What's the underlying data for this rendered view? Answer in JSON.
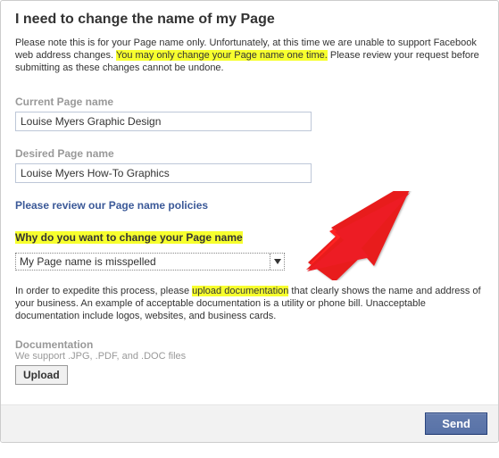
{
  "title": "I need to change the name of my Page",
  "intro": {
    "part1": "Please note this is for your Page name only. Unfortunately, at this time we are unable to support Facebook web address changes. ",
    "highlight1": "You may only change your Page name one time.",
    "part2": " Please review your request before submitting as these changes cannot be undone."
  },
  "current": {
    "label": "Current Page name",
    "value": "Louise Myers Graphic Design"
  },
  "desired": {
    "label": "Desired Page name",
    "value": "Louise Myers How-To Graphics"
  },
  "policy_link": "Please review our Page name policies",
  "why": {
    "label": "Why do you want to change your Page name",
    "selected": "My Page name is misspelled"
  },
  "expedite": {
    "part1": "In order to expedite this process, please ",
    "highlight": "upload documentation",
    "part2": " that clearly shows the name and address of your business. An example of acceptable documentation is a utility or phone bill. Unacceptable documentation include logos, websites, and business cards."
  },
  "documentation": {
    "label": "Documentation",
    "support": "We support .JPG, .PDF, and .DOC files",
    "button": "Upload"
  },
  "footer": {
    "send": "Send"
  }
}
